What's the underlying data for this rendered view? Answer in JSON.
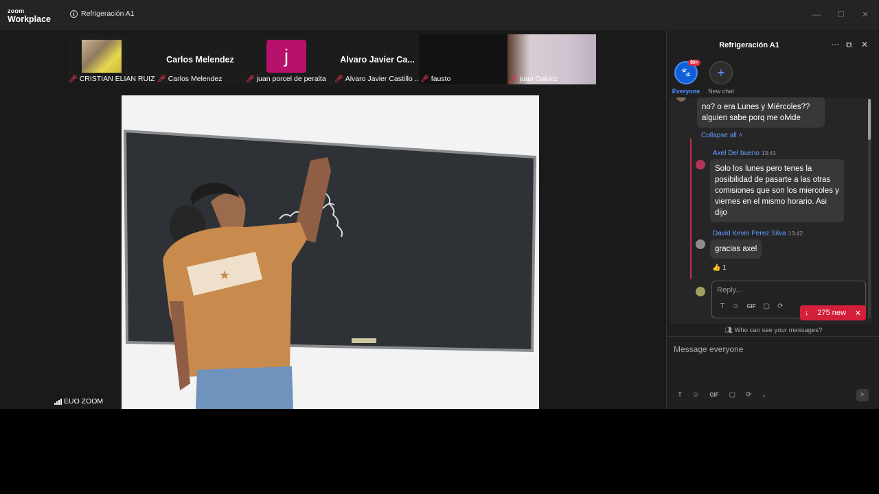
{
  "titlebar": {
    "logo_top": "zoom",
    "logo_bottom": "Workplace",
    "meeting_title": "Refrigeración A1",
    "minimize": "—",
    "maximize": "☐",
    "close": "✕"
  },
  "participants": [
    {
      "label": "CRISTIAN ELIAN RUIZ",
      "display": "photo"
    },
    {
      "label": "Carlos Melendez",
      "display": "name",
      "big_name": "Carlos Melendez"
    },
    {
      "label": "juan porcel de peralta",
      "display": "initial",
      "initial": "j"
    },
    {
      "label": "Alvaro Javier Castillo ...",
      "display": "name",
      "big_name": "Alvaro Javier Ca..."
    },
    {
      "label": "fausto",
      "display": "camera-dark"
    },
    {
      "label": "juan Galvez",
      "display": "camera"
    }
  ],
  "connection": {
    "label": "EUO ZOOM"
  },
  "chat": {
    "title": "Refrigeración A1",
    "channels": [
      {
        "label": "Everyone",
        "badge": "99+"
      },
      {
        "label": "New chat"
      }
    ],
    "first_message": "no? o era Lunes y Miércoles?? alguien sabe porq me olvide",
    "collapse_label": "Collapse all",
    "replies": [
      {
        "sender": "Axel Del bueno",
        "time": "13:41",
        "text": "Solo los lunes pero tenes la posibilidad de pasarte a las otras comisiones que son los miercoles y viernes en el mismo horario. Asi dijo"
      },
      {
        "sender": "David Kevin Perez Silva",
        "time": "13:42",
        "text": "gracias axel"
      }
    ],
    "reaction": {
      "emoji": "👍",
      "count": "1"
    },
    "reply_placeholder": "Reply...",
    "new_messages": "275 new",
    "who_can_see": "Who can see your messages?",
    "compose_placeholder": "Message everyone",
    "tool_labels": {
      "text": "T",
      "emoji": "☺",
      "gif": "GIF",
      "file": "▢",
      "more": "⟳"
    }
  },
  "colors": {
    "accent_blue": "#0e5fd8",
    "link_blue": "#62a0ff",
    "alert_red": "#d41f3a",
    "avatar_magenta": "#b7126b"
  }
}
